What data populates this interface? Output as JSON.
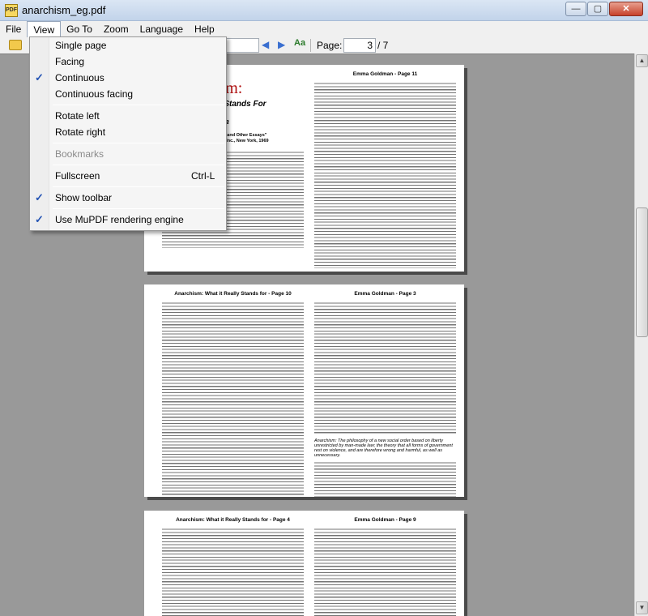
{
  "window": {
    "title": "anarchism_eg.pdf",
    "app_icon_text": "PDF",
    "minimize_glyph": "—",
    "maximize_glyph": "▢",
    "close_glyph": "✕"
  },
  "menubar": [
    "File",
    "View",
    "Go To",
    "Zoom",
    "Language",
    "Help"
  ],
  "active_menu": "View",
  "toolbar": {
    "page_label": "Page:",
    "page_value": "3",
    "page_total": "/ 7",
    "prev_glyph": "◀",
    "next_glyph": "▶",
    "find_glyph": "Aa"
  },
  "view_menu": {
    "items": [
      {
        "label": "Single page",
        "checked": false
      },
      {
        "label": "Facing",
        "checked": false
      },
      {
        "label": "Continuous",
        "checked": true
      },
      {
        "label": "Continuous facing",
        "checked": false
      },
      {
        "label": "Rotate left",
        "checked": false
      },
      {
        "label": "Rotate right",
        "checked": false
      },
      {
        "label": "Bookmarks",
        "checked": false,
        "disabled": true
      },
      {
        "label": "Fullscreen",
        "shortcut": "Ctrl-L",
        "checked": false
      },
      {
        "label": "Show toolbar",
        "checked": true
      },
      {
        "label": "Use MuPDF rendering engine",
        "checked": true
      }
    ],
    "check_glyph": "✓"
  },
  "pages": [
    {
      "left_header": "",
      "right_header": "Emma Goldman  -  Page 11",
      "title": "Anarchism:",
      "subtitle": "What it Really Stands For",
      "author": "Emma Goldman",
      "byline_1": "From the book \"Anarchism and Other Essays\"",
      "byline_2": "Mother Earth Publications, Inc., New York, 1969"
    },
    {
      "left_header": "Anarchism: What it Really Stands for  -  Page 10",
      "right_header": "Emma Goldman  -  Page 3",
      "italic_note": "Anarchism: The philosophy of a new social order based on liberty unrestricted by man-made law; the theory that all forms of government rest on violence, and are therefore wrong and harmful, as well as unnecessary."
    },
    {
      "left_header": "Anarchism: What it Really Stands for  -  Page 4",
      "right_header": "Emma Goldman  -  Page 9"
    }
  ],
  "scrollbar": {
    "up_glyph": "▲",
    "down_glyph": "▼"
  }
}
